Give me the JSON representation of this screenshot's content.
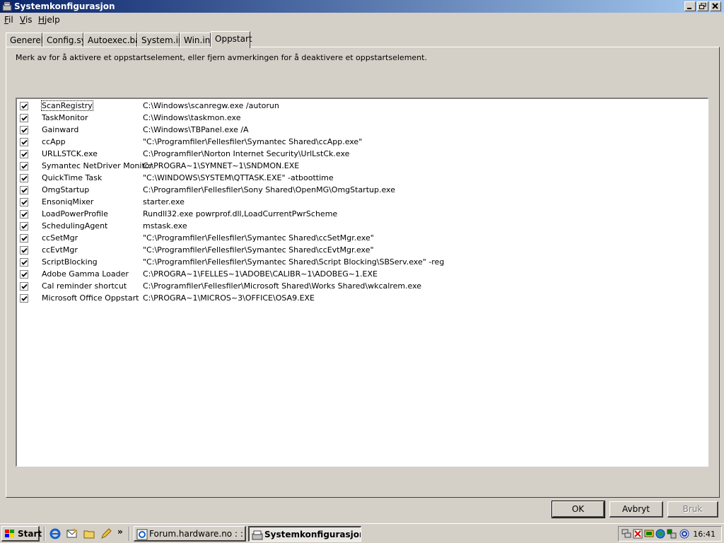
{
  "window": {
    "title": "Systemkonfigurasjon"
  },
  "menu": [
    {
      "label": "Fil",
      "accel": "F"
    },
    {
      "label": "Vis",
      "accel": "V"
    },
    {
      "label": "Hjelp",
      "accel": "H"
    }
  ],
  "tabs": [
    {
      "label": "Generelt"
    },
    {
      "label": "Config.sys"
    },
    {
      "label": "Autoexec.bat"
    },
    {
      "label": "System.ini"
    },
    {
      "label": "Win.ini"
    },
    {
      "label": "Oppstart",
      "active": true
    }
  ],
  "instruction": "Merk av for å aktivere et oppstartselement, eller fjern avmerkingen for å deaktivere  et oppstartselement.",
  "startup_items": [
    {
      "name": "ScanRegistry",
      "command": "C:\\Windows\\scanregw.exe /autorun",
      "checked": true
    },
    {
      "name": "TaskMonitor",
      "command": "C:\\Windows\\taskmon.exe",
      "checked": true
    },
    {
      "name": "Gainward",
      "command": "C:\\Windows\\TBPanel.exe /A",
      "checked": true
    },
    {
      "name": "ccApp",
      "command": "\"C:\\Programfiler\\Fellesfiler\\Symantec Shared\\ccApp.exe\"",
      "checked": true
    },
    {
      "name": "URLLSTCK.exe",
      "command": "C:\\Programfiler\\Norton Internet Security\\UrlLstCk.exe",
      "checked": true
    },
    {
      "name": "Symantec NetDriver Monitor",
      "command": "C:\\PROGRA~1\\SYMNET~1\\SNDMON.EXE",
      "checked": true
    },
    {
      "name": "QuickTime Task",
      "command": "\"C:\\WINDOWS\\SYSTEM\\QTTASK.EXE\" -atboottime",
      "checked": true
    },
    {
      "name": "OmgStartup",
      "command": "C:\\Programfiler\\Fellesfiler\\Sony Shared\\OpenMG\\OmgStartup.exe",
      "checked": true
    },
    {
      "name": "EnsoniqMixer",
      "command": "starter.exe",
      "checked": true
    },
    {
      "name": "LoadPowerProfile",
      "command": "Rundll32.exe powrprof.dll,LoadCurrentPwrScheme",
      "checked": true
    },
    {
      "name": "SchedulingAgent",
      "command": "mstask.exe",
      "checked": true
    },
    {
      "name": "ccSetMgr",
      "command": "\"C:\\Programfiler\\Fellesfiler\\Symantec Shared\\ccSetMgr.exe\"",
      "checked": true
    },
    {
      "name": "ccEvtMgr",
      "command": "\"C:\\Programfiler\\Fellesfiler\\Symantec Shared\\ccEvtMgr.exe\"",
      "checked": true
    },
    {
      "name": "ScriptBlocking",
      "command": "\"C:\\Programfiler\\Fellesfiler\\Symantec Shared\\Script Blocking\\SBServ.exe\" -reg",
      "checked": true
    },
    {
      "name": "Adobe Gamma Loader",
      "command": "C:\\PROGRA~1\\FELLES~1\\ADOBE\\CALIBR~1\\ADOBEG~1.EXE",
      "checked": true
    },
    {
      "name": "Cal reminder shortcut",
      "command": "C:\\Programfiler\\Fellesfiler\\Microsoft Shared\\Works Shared\\wkcalrem.exe",
      "checked": true
    },
    {
      "name": "Microsoft Office Oppstart",
      "command": "C:\\PROGRA~1\\MICROS~3\\OFFICE\\OSA9.EXE",
      "checked": true
    }
  ],
  "buttons": {
    "ok": "OK",
    "cancel": "Avbryt",
    "apply": "Bruk"
  },
  "taskbar": {
    "start_label": "Start",
    "quick_launch": [
      "ie-icon",
      "outlook-express-icon",
      "folder-icon",
      "pencil-icon"
    ],
    "more": "»",
    "tasks": [
      {
        "label": "Forum.hardware.no : : Foru...",
        "icon": "ie-icon"
      },
      {
        "label": "Systemkonfigurasjon",
        "icon": "sysconfig-icon",
        "active": true
      }
    ],
    "tray_icons": [
      "network-icon",
      "norton-icon",
      "display-icon",
      "globe-icon",
      "speaker-icon",
      "quicktime-icon"
    ],
    "clock": "16:41"
  }
}
